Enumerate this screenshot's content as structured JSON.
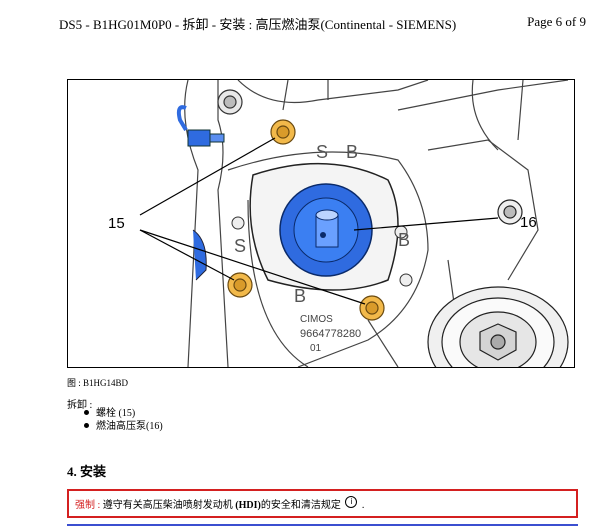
{
  "header": {
    "title": "DS5 - B1HG01M0P0 - 拆卸  - 安装 : 高压燃油泵(Continental - SIEMENS)",
    "page": "Page 6 of 9"
  },
  "figure": {
    "callouts": [
      "15",
      "16"
    ],
    "part_number": "9664778280",
    "part_suffix": "01",
    "brand": "CIMOS",
    "letters": [
      "S",
      "B"
    ],
    "caption": "图 : B1HG14BD"
  },
  "removal": {
    "title": "拆卸 :",
    "items": [
      "螺栓  (15)",
      "燃油高压泵(16)"
    ]
  },
  "install": {
    "heading": "4. 安装"
  },
  "warning": {
    "label": "强制 : ",
    "text_before": "遵守有关高压柴油喷射发动机 ",
    "bold": "(HDI)",
    "text_after": "的安全和清洁规定",
    "icon": "i",
    "end": " ."
  },
  "colors": {
    "accent_blue": "#2f6be0",
    "bolt_yellow": "#f2b94a",
    "warning_red": "#d42020"
  }
}
